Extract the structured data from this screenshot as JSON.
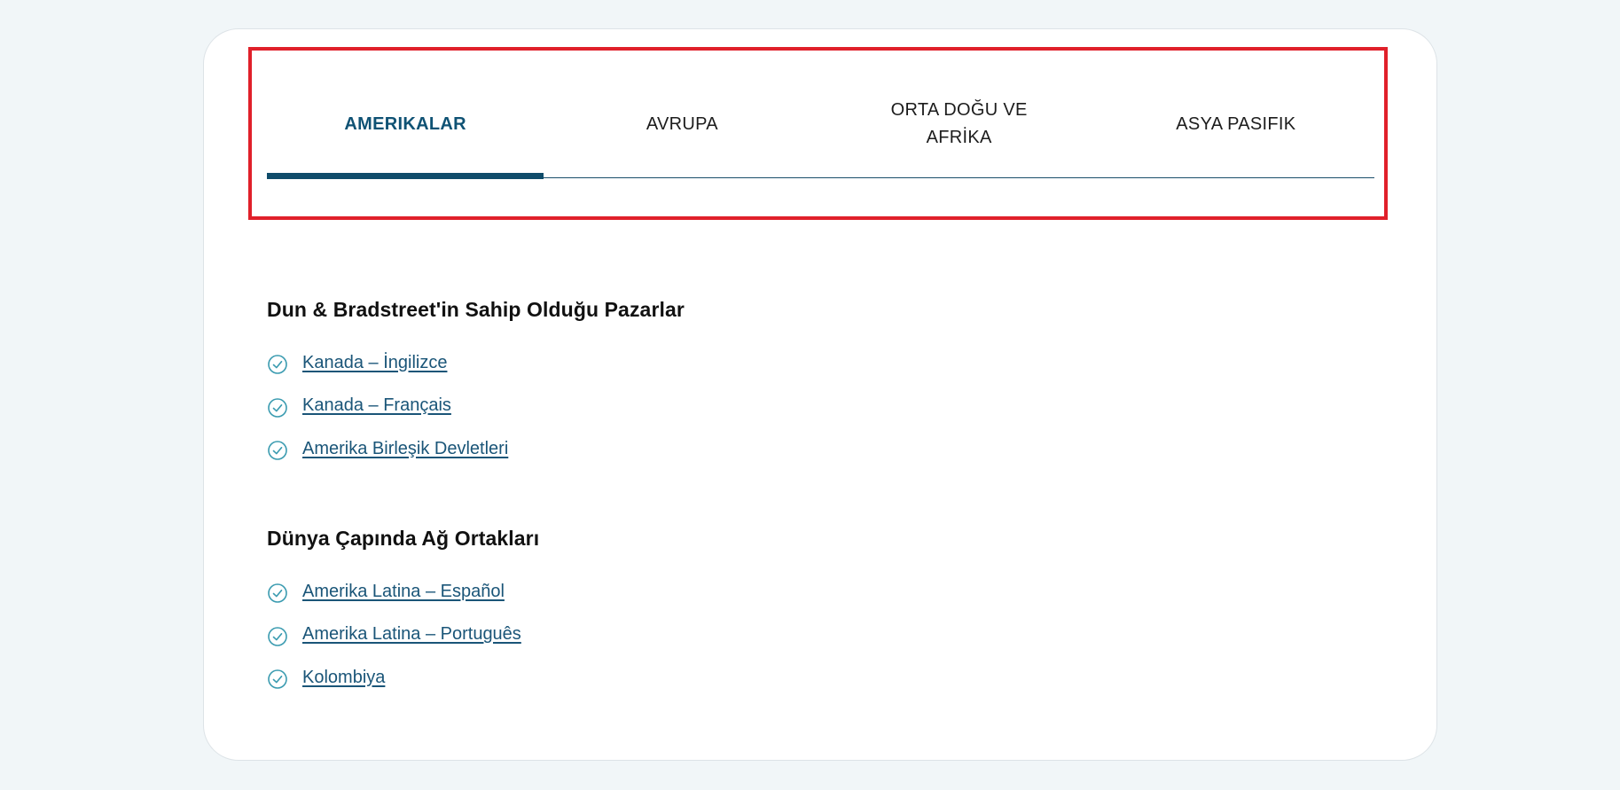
{
  "tabs": [
    {
      "label": "AMERIKALAR",
      "active": true
    },
    {
      "label": "AVRUPA",
      "active": false
    },
    {
      "label": "ORTA DOĞU VE AFRİKA",
      "active": false
    },
    {
      "label": "ASYA PASIFIK",
      "active": false
    }
  ],
  "sections": [
    {
      "title": "Dun & Bradstreet'in Sahip Olduğu Pazarlar",
      "links": [
        "Kanada – İngilizce",
        "Kanada – Français",
        "Amerika Birleşik Devletleri"
      ]
    },
    {
      "title": "Dünya Çapında Ağ Ortakları",
      "links": [
        "Amerika Latina – Español",
        "Amerika Latina – Português",
        "Kolombiya"
      ]
    }
  ],
  "icons": {
    "link_marker": "check-circle-icon"
  },
  "colors": {
    "accent": "#0f5274",
    "link": "#1a5578",
    "check_icon": "#3a9bb0",
    "highlight": "#e0202a",
    "background": "#f1f6f8"
  }
}
